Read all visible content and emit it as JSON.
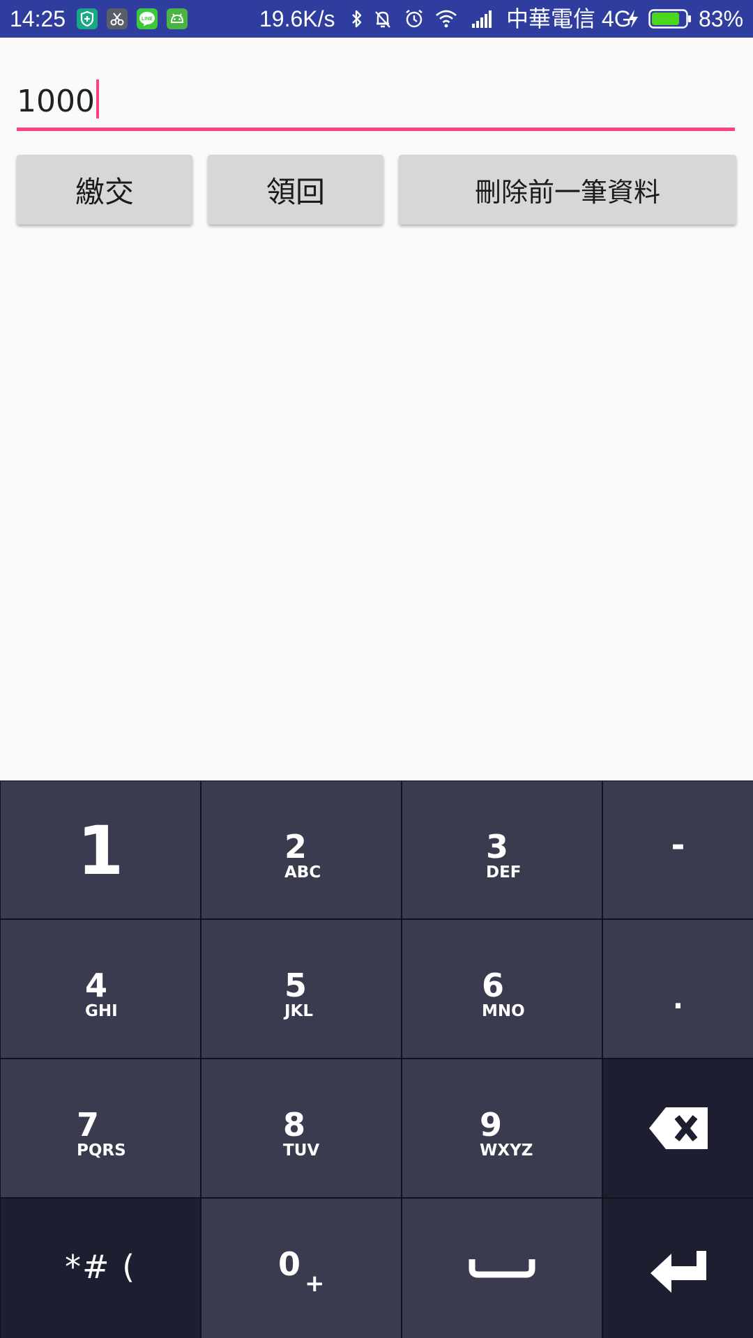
{
  "status_bar": {
    "time": "14:25",
    "network_speed": "19.6K/s",
    "carrier": "中華電信 4G",
    "battery_percent": "83%",
    "battery_level": 0.83,
    "app_icons": [
      "shield-app-icon",
      "scissors-app-icon",
      "line-app-icon",
      "android-app-icon"
    ],
    "line_label": "LINE",
    "system_icons": [
      "bluetooth-icon",
      "notifications-muted-icon",
      "alarm-icon",
      "wifi-icon",
      "signal-icon",
      "charging-icon",
      "battery-icon"
    ],
    "colors": {
      "background": "#2f3e9e",
      "battery_fill": "#4cd61e"
    }
  },
  "amount_input": {
    "value": "1000",
    "underline_color": "#ff4081"
  },
  "buttons": {
    "pay": "繳交",
    "withdraw": "領回",
    "delete_last": "刪除前一筆資料"
  },
  "keypad": {
    "rows": [
      [
        {
          "num": "1",
          "letters": ""
        },
        {
          "num": "2",
          "letters": "ABC"
        },
        {
          "num": "3",
          "letters": "DEF"
        },
        {
          "symbol": "-"
        }
      ],
      [
        {
          "num": "4",
          "letters": "GHI"
        },
        {
          "num": "5",
          "letters": "JKL"
        },
        {
          "num": "6",
          "letters": "MNO"
        },
        {
          "symbol": "."
        }
      ],
      [
        {
          "num": "7",
          "letters": "PQRS"
        },
        {
          "num": "8",
          "letters": "TUV"
        },
        {
          "num": "9",
          "letters": "WXYZ"
        },
        {
          "icon": "backspace-icon"
        }
      ],
      [
        {
          "symbol": "*# ("
        },
        {
          "num": "0",
          "letters": "+"
        },
        {
          "icon": "space-icon"
        },
        {
          "icon": "enter-icon"
        }
      ]
    ],
    "colors": {
      "key": "#3a3b4f",
      "function_key": "#1e1e31",
      "gap": "#12121a"
    }
  }
}
